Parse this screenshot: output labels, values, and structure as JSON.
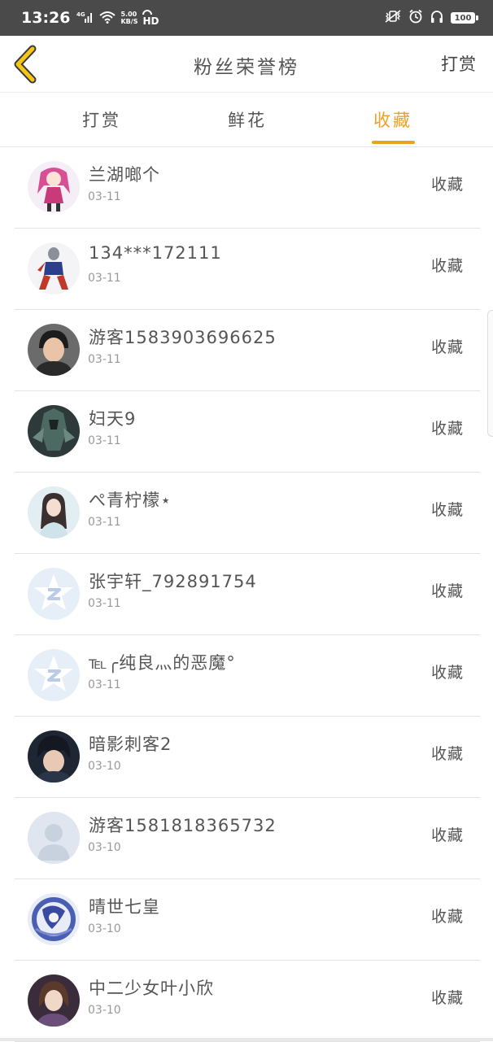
{
  "status_bar": {
    "time": "13:26",
    "network": "4G",
    "speed_value": "5.00",
    "speed_unit": "KB/S",
    "hd": "HD",
    "battery": "100"
  },
  "nav": {
    "title": "粉丝荣誉榜",
    "reward_label": "打赏"
  },
  "tabs": [
    {
      "label": "打赏",
      "active": false
    },
    {
      "label": "鲜花",
      "active": false
    },
    {
      "label": "收藏",
      "active": true
    }
  ],
  "colors": {
    "accent": "#f0a020",
    "status_bar": "#4a4a4a"
  },
  "fans": [
    {
      "name": "兰湖啷个",
      "date": "03-11",
      "action": "收藏",
      "avatar": "anime-girl-avatar"
    },
    {
      "name": "134***172111",
      "date": "03-11",
      "action": "收藏",
      "avatar": "ultraman-avatar"
    },
    {
      "name": "游客1583903696625",
      "date": "03-11",
      "action": "收藏",
      "avatar": "person-photo-avatar"
    },
    {
      "name": "妇天9",
      "date": "03-11",
      "action": "收藏",
      "avatar": "dark-warrior-avatar"
    },
    {
      "name": "ぺ青柠檬⋆",
      "date": "03-11",
      "action": "收藏",
      "avatar": "girl-photo-avatar"
    },
    {
      "name": "张宇轩_792891754",
      "date": "03-11",
      "action": "收藏",
      "avatar": "qzone-default-avatar"
    },
    {
      "name": "℡╭纯良灬的恶魔°",
      "date": "03-11",
      "action": "收藏",
      "avatar": "qzone-default-avatar"
    },
    {
      "name": "暗影刺客2",
      "date": "03-10",
      "action": "收藏",
      "avatar": "anime-boy-avatar"
    },
    {
      "name": "游客1581818365732",
      "date": "03-10",
      "action": "收藏",
      "avatar": "default-person-avatar"
    },
    {
      "name": "晴世七皇",
      "date": "03-10",
      "action": "收藏",
      "avatar": "blue-anime-avatar"
    },
    {
      "name": "中二少女叶小欣",
      "date": "03-10",
      "action": "收藏",
      "avatar": "fantasy-girl-avatar"
    }
  ]
}
